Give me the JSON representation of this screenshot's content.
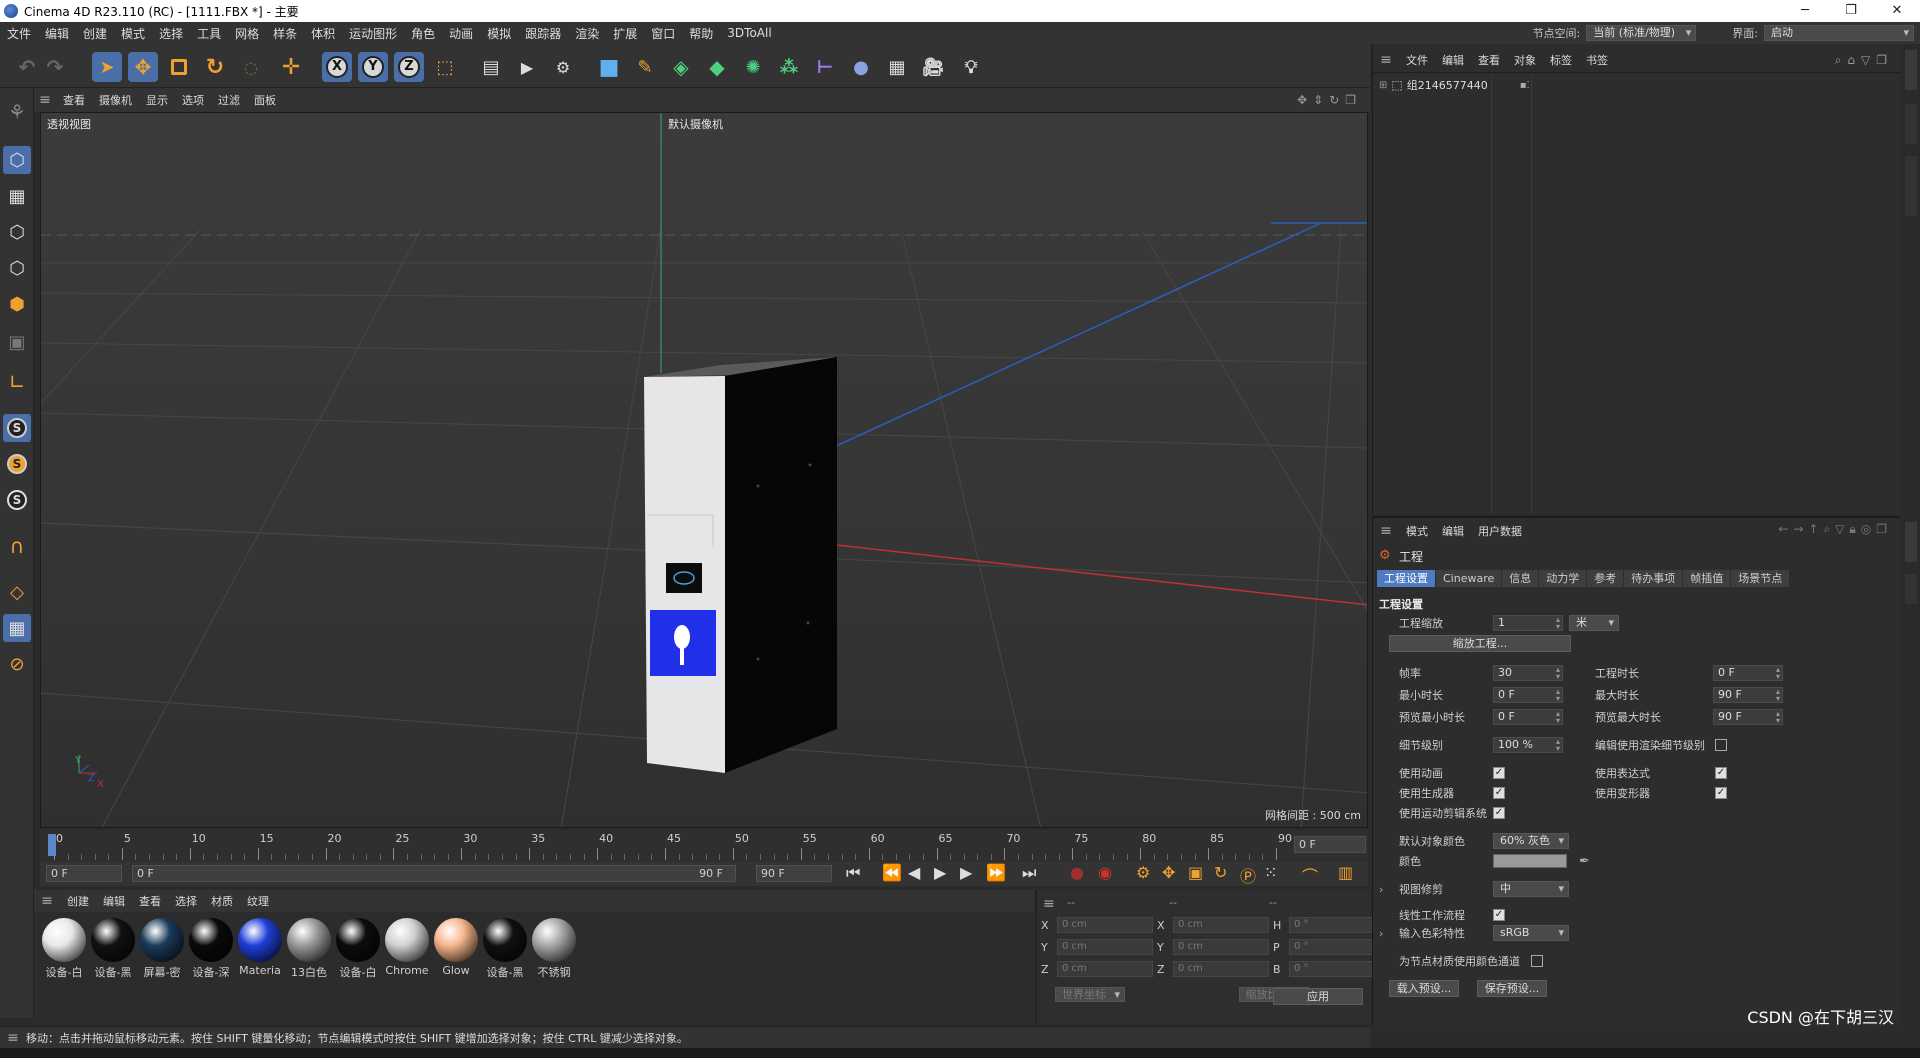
{
  "window": {
    "title": "Cinema 4D R23.110 (RC) - [1111.FBX *] - 主要",
    "controls": [
      "─",
      "❐",
      "✕"
    ]
  },
  "menubar": {
    "items": [
      "文件",
      "编辑",
      "创建",
      "模式",
      "选择",
      "工具",
      "网格",
      "样条",
      "体积",
      "运动图形",
      "角色",
      "动画",
      "模拟",
      "跟踪器",
      "渲染",
      "扩展",
      "窗口",
      "帮助",
      "3DToAll"
    ],
    "node_space_label": "节点空间:",
    "node_space_value": "当前 (标准/物理)",
    "layout_label": "界面:",
    "layout_value": "启动"
  },
  "toolbar": {
    "axis_x": "X",
    "axis_y": "Y",
    "axis_z": "Z",
    "icons": [
      "undo-icon",
      "redo-icon",
      "select-icon",
      "move-icon",
      "scale-icon",
      "rotate-icon",
      "live-select-icon",
      "transform-icon",
      "coordinate-system-icon",
      "render-region-icon",
      "render-view-icon",
      "render-settings-icon",
      "cube-icon",
      "pen-icon",
      "subdivision-icon",
      "extrude-icon",
      "cloner-icon",
      "array-icon",
      "spline-icon",
      "deformer-icon",
      "floor-icon",
      "camera-icon",
      "light-icon"
    ]
  },
  "viewport": {
    "menu": [
      "查看",
      "摄像机",
      "显示",
      "选项",
      "过滤",
      "面板"
    ],
    "view_name": "透视视图",
    "camera_label": "默认摄像机",
    "grid_spacing": "网格间距 : 500 cm",
    "axis_labels": {
      "y": "Y",
      "z": "Z",
      "x": "X"
    }
  },
  "timeline": {
    "ticks": [
      "0",
      "5",
      "10",
      "15",
      "20",
      "25",
      "30",
      "35",
      "40",
      "45",
      "50",
      "55",
      "60",
      "65",
      "70",
      "75",
      "80",
      "85",
      "90"
    ],
    "current_frame": "0 F",
    "start_field": "0 F",
    "range_start": "0 F",
    "range_end": "90 F",
    "end_field": "90 F"
  },
  "material_manager": {
    "menu": [
      "创建",
      "编辑",
      "查看",
      "选择",
      "材质",
      "纹理"
    ],
    "materials": [
      {
        "label": "设备-白",
        "color": "#e8e8e8"
      },
      {
        "label": "设备-黑",
        "color": "#111111"
      },
      {
        "label": "屏幕-密",
        "color": "#1a3a5a"
      },
      {
        "label": "设备-深",
        "color": "#0a0a0a"
      },
      {
        "label": "Materia",
        "color": "#1e3fd8"
      },
      {
        "label": "13白色",
        "color": "#9a9a9a"
      },
      {
        "label": "设备-白",
        "color": "#0c0c0c"
      },
      {
        "label": "Chrome",
        "color": "#d0d0d0"
      },
      {
        "label": "Glow",
        "color": "#f7b58c"
      },
      {
        "label": "设备-黑",
        "color": "#101010"
      },
      {
        "label": "不锈钢",
        "color": "#a8a8a8"
      }
    ]
  },
  "coordinates": {
    "headers": [
      "--",
      "--",
      "--"
    ],
    "rows": [
      {
        "a": "X",
        "av": "0 cm",
        "b": "X",
        "bv": "0 cm",
        "c": "H",
        "cv": "0 °"
      },
      {
        "a": "Y",
        "av": "0 cm",
        "b": "Y",
        "bv": "0 cm",
        "c": "P",
        "cv": "0 °"
      },
      {
        "a": "Z",
        "av": "0 cm",
        "b": "Z",
        "bv": "0 cm",
        "c": "B",
        "cv": "0 °"
      }
    ],
    "world_coords": "世界坐标",
    "scale_mode": "缩放比例",
    "apply": "应用"
  },
  "object_manager": {
    "menu": [
      "文件",
      "编辑",
      "查看",
      "对象",
      "标签",
      "书签"
    ],
    "object_name": "组2146577440"
  },
  "attribute_manager": {
    "menu": [
      "模式",
      "编辑",
      "用户数据"
    ],
    "heading": "工程",
    "tabs": [
      "工程设置",
      "Cineware",
      "信息",
      "动力学",
      "参考",
      "待办事项",
      "帧插值",
      "场景节点"
    ],
    "section": "工程设置",
    "project_scale_label": "工程缩放",
    "project_scale_value": "1",
    "project_scale_unit": "米",
    "scale_project_btn": "缩放工程...",
    "fps_label": "帧率",
    "fps_value": "30",
    "project_time_label": "工程时长",
    "project_time_value": "0 F",
    "min_time_label": "最小时长",
    "min_time_value": "0 F",
    "max_time_label": "最大时长",
    "max_time_value": "90 F",
    "preview_min_label": "预览最小时长",
    "preview_min_value": "0 F",
    "preview_max_label": "预览最大时长",
    "preview_max_value": "90 F",
    "lod_label": "细节级别",
    "lod_value": "100 %",
    "render_lod_label": "编辑使用渲染细节级别",
    "use_anim_label": "使用动画",
    "use_expr_label": "使用表达式",
    "use_gen_label": "使用生成器",
    "use_deform_label": "使用变形器",
    "use_motion_label": "使用运动剪辑系统",
    "default_color_label": "默认对象颜色",
    "default_color_value": "60% 灰色",
    "color_label": "颜色",
    "view_clip_label": "视图修剪",
    "view_clip_value": "中",
    "linear_label": "线性工作流程",
    "input_profile_label": "输入色彩特性",
    "input_profile_value": "sRGB",
    "node_mat_label": "为节点材质使用颜色通道",
    "load_preset": "载入预设...",
    "save_preset": "保存预设..."
  },
  "statusbar": {
    "text": "移动：点击并拖动鼠标移动元素。按住 SHIFT 键量化移动；节点编辑模式时按住 SHIFT 键增加选择对象；按住 CTRL 键减少选择对象。"
  },
  "watermark": "CSDN @在下胡三汉"
}
